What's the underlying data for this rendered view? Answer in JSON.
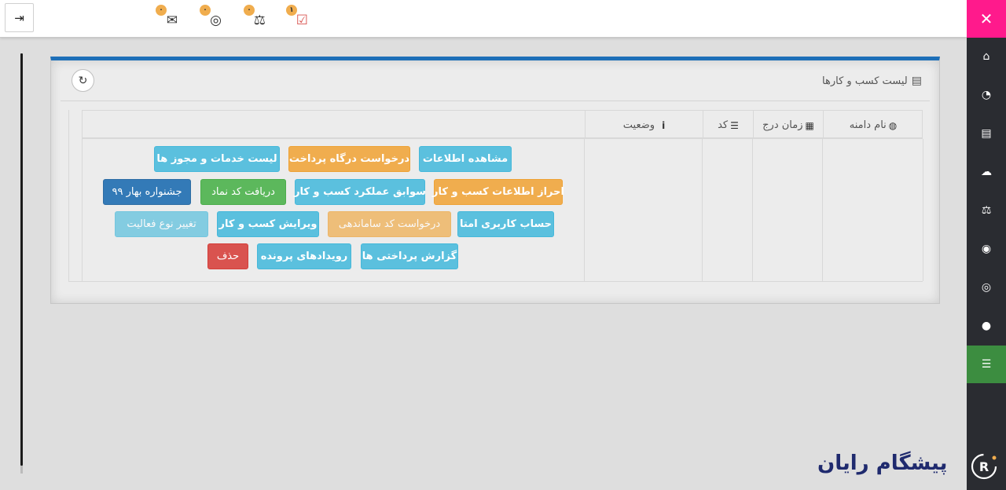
{
  "topbar": {
    "notifications": [
      {
        "icon": "envelope-open-icon",
        "badge": "۰"
      },
      {
        "icon": "life-ring-icon",
        "badge": "۰"
      },
      {
        "icon": "balance-scale-icon",
        "badge": "۰"
      },
      {
        "icon": "calendar-check-icon",
        "badge": "۱"
      }
    ],
    "logout_icon": "sign-out-icon"
  },
  "sidebar": {
    "close_icon": "close-icon",
    "items": [
      {
        "icon": "home-icon"
      },
      {
        "icon": "dashboard-icon"
      },
      {
        "icon": "id-card-icon"
      },
      {
        "icon": "cloud-icon"
      },
      {
        "icon": "balance-scale-icon"
      },
      {
        "icon": "eye-icon"
      },
      {
        "icon": "life-ring-icon"
      },
      {
        "icon": "user-icon"
      },
      {
        "icon": "list-indent-icon",
        "active": true
      }
    ],
    "active_color": "#3c8d40"
  },
  "panel": {
    "title": "لیست کسب و کارها",
    "accent_color": "#1d6fb8"
  },
  "table": {
    "headers": {
      "domain": "نام دامنه",
      "date": "زمان درج",
      "code": "کد",
      "status": "وضعیت"
    }
  },
  "actions": {
    "view_info": "مشاهده اطلاعات",
    "gateway_request": "درخواست درگاه پرداخت",
    "services_list": "لیست خدمات و مجوز ها",
    "verify_info": "احراز اطلاعات کسب و کار",
    "performance_history": "سوابق عملکرد کسب و کار",
    "get_enamad": "دریافت کد نماد",
    "festival": "جشنواره بهار ۹۹",
    "amta_account": "حساب کاربری امتا",
    "organize_request": "درخواست کد ساماندهی",
    "edit_business": "ویرایش کسب و کار",
    "change_activity": "تغییر نوع فعالیت",
    "payment_report": "گزارش پرداختی ها",
    "file_events": "رویدادهای پرونده",
    "delete": "حذف"
  },
  "brand": {
    "name": "پیشگام رایان"
  }
}
